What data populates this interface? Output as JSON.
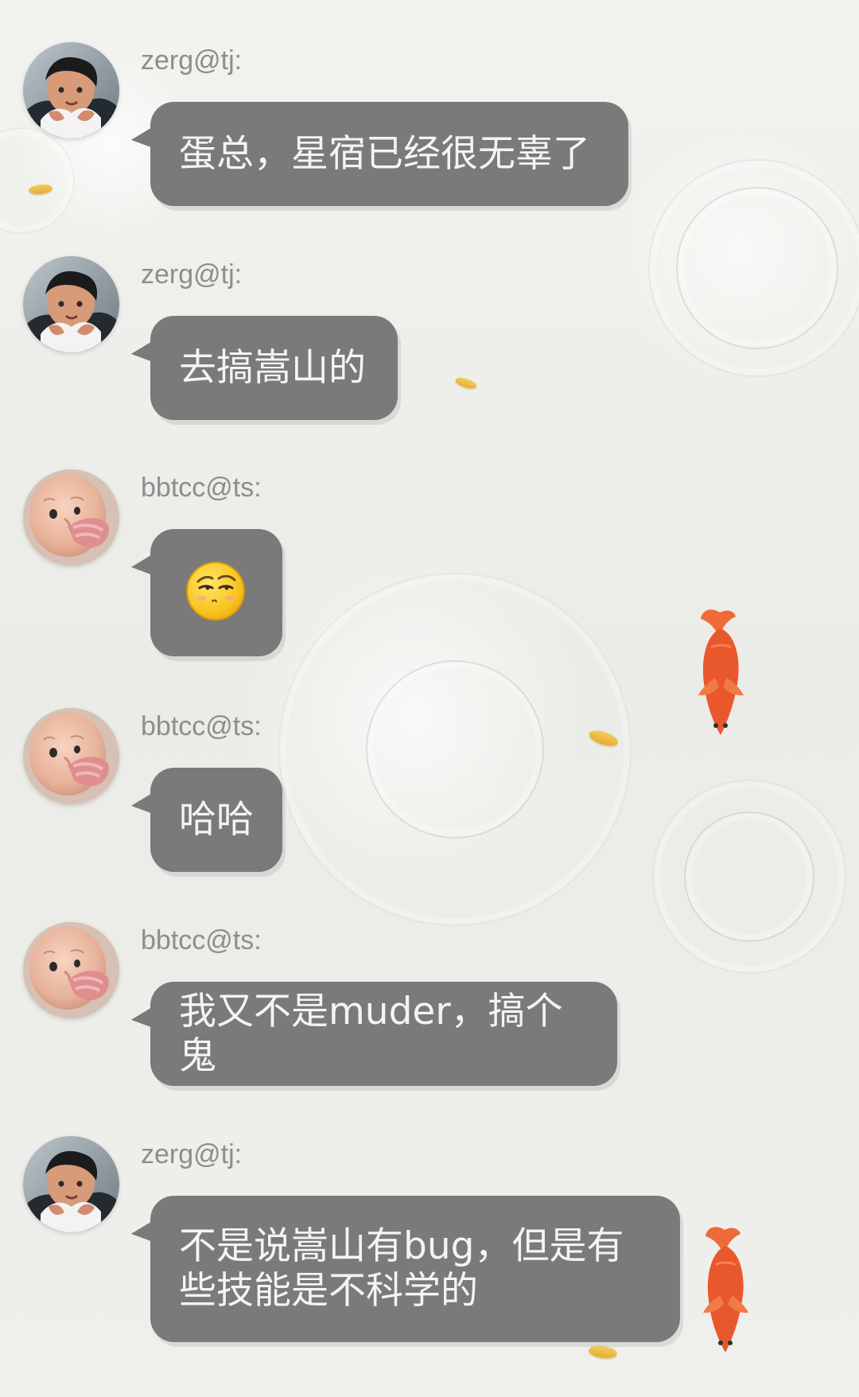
{
  "background": {
    "theme": "water-ripple-koi",
    "accent_colors": {
      "bubble": "#7a7a7a",
      "bubble_text": "#f4f4f4",
      "sender_text": "#8d8d8d",
      "seed": "#e7aa2f",
      "koi": "#e6532b"
    }
  },
  "chat": {
    "messages": [
      {
        "sender": "zerg@tj:",
        "avatar_icon": "child-avatar-zerg",
        "text": "蛋总，星宿已经很无辜了"
      },
      {
        "sender": "zerg@tj:",
        "avatar_icon": "child-avatar-zerg",
        "text": "去搞嵩山的"
      },
      {
        "sender": "bbtcc@ts:",
        "avatar_icon": "baby-avatar-bbtcc",
        "emoji": "side-eye-emoji"
      },
      {
        "sender": "bbtcc@ts:",
        "avatar_icon": "baby-avatar-bbtcc",
        "text": "哈哈"
      },
      {
        "sender": "bbtcc@ts:",
        "avatar_icon": "baby-avatar-bbtcc",
        "text": "我又不是muder，搞个鬼"
      },
      {
        "sender": "zerg@tj:",
        "avatar_icon": "child-avatar-zerg",
        "text": "不是说嵩山有bug，但是有些技能是不科学的"
      }
    ]
  }
}
